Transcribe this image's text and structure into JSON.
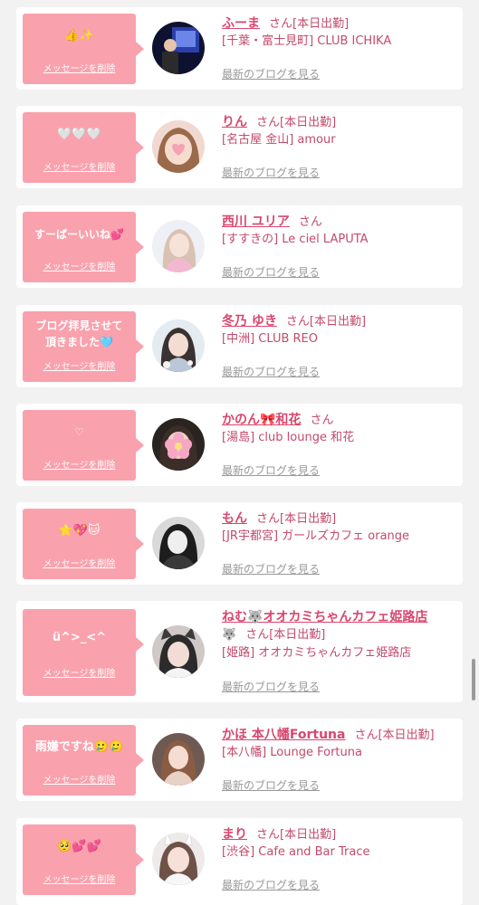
{
  "delete_label": "メッセージを削除",
  "blog_label": "最新のブログを見る",
  "san_label": "さん",
  "colors": {
    "bubble": "#f9a1ad",
    "name": "#d9466e",
    "shop": "#c44a6b",
    "background": "#f2f2f2"
  },
  "entries": [
    {
      "message": "👍✨",
      "name": "ふーま",
      "status": "[本日出勤]",
      "shop": "[千葉・富士見町] CLUB ICHIKA",
      "avatar": "nightclub-photo"
    },
    {
      "message": "🤍🤍🤍",
      "name": "りん",
      "status": "[本日出勤]",
      "shop": "[名古屋 金山] amour",
      "avatar": "heart-face-photo"
    },
    {
      "message": "すーぱーいいね💕",
      "name": "西川 ユリア",
      "status": "",
      "shop": "[すすきの] Le ciel LAPUTA",
      "avatar": "pink-outfit-photo"
    },
    {
      "message": "ブログ拝見させて\n頂きました🩵",
      "name": "冬乃 ゆき",
      "status": "[本日出勤]",
      "shop": "[中洲] CLUB REO",
      "avatar": "floral-photo"
    },
    {
      "message": "♡",
      "name": "かのん🎀和花",
      "status": "",
      "shop": "[湯島] club lounge 和花",
      "avatar": "flower-face-photo"
    },
    {
      "message": "⭐💖🐱",
      "name": "もん",
      "status": "[本日出勤]",
      "shop": "[JR宇都宮] ガールズカフェ orange",
      "avatar": "monochrome-photo"
    },
    {
      "message": "ü^>_<^",
      "name": "ねむ🐺オオカミちゃんカフェ姫路店",
      "name_suffix": "🐺",
      "status": "[本日出勤]",
      "shop": "[姫路] オオカミちゃんカフェ姫路店",
      "avatar": "wolf-ears-photo"
    },
    {
      "message": "雨嫌ですね🥲🥲",
      "name": "かほ 本八幡Fortuna",
      "status": "[本日出勤]",
      "shop": "[本八幡] Lounge Fortuna",
      "avatar": "selfie-photo"
    },
    {
      "message": "🥺💕💕",
      "name": "まり",
      "status": "[本日出勤]",
      "shop": "[渋谷] Cafe and Bar Trace",
      "avatar": "bunny-ears-photo"
    }
  ]
}
